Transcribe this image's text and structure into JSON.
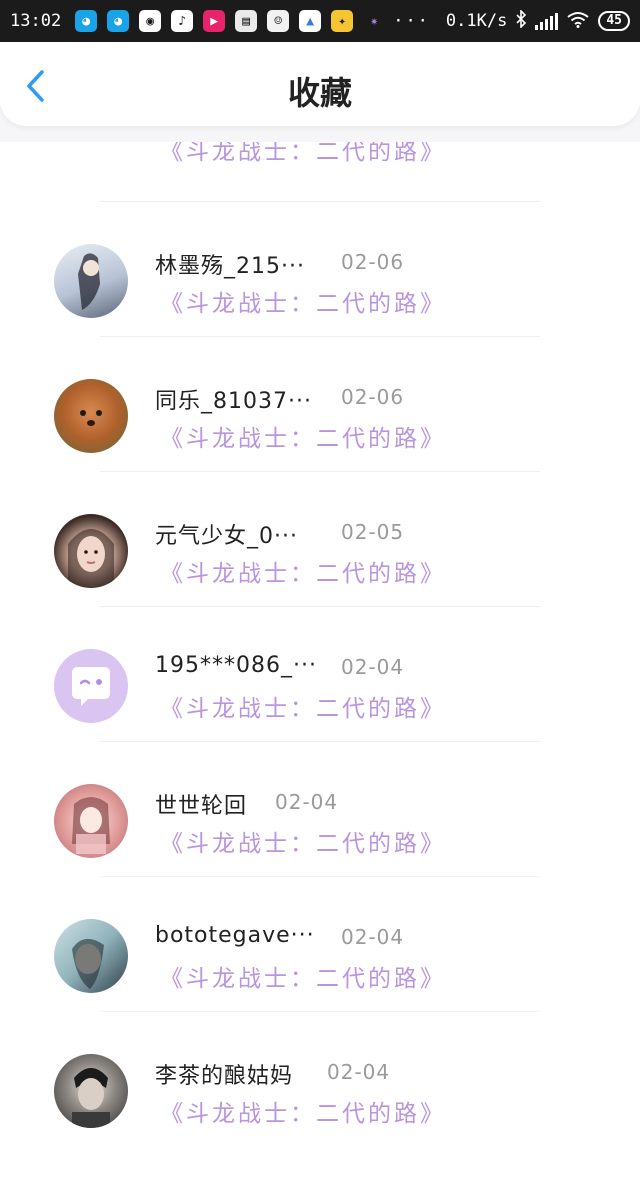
{
  "status_bar": {
    "time": "13:02",
    "dots": "···",
    "speed": "0.1K/s",
    "battery": "45",
    "app_icons": [
      "qq-icon",
      "qq-icon",
      "wechat-icon",
      "music-icon",
      "video-icon",
      "news-icon",
      "chat-icon",
      "image-icon",
      "game-icon",
      "app-icon"
    ]
  },
  "header": {
    "title": "收藏",
    "back_icon": "chevron-left-icon",
    "accent_color": "#2e9cf0"
  },
  "items": [
    {
      "name": "",
      "date": "",
      "quote": "《斗龙战士：二代的路》",
      "avatar_color": "#2a5d9c"
    },
    {
      "name": "林墨殇_215···",
      "date": "02-06",
      "quote": "《斗龙战士：二代的路》",
      "avatar_color": "#b9c6d8"
    },
    {
      "name": "同乐_81037···",
      "date": "02-06",
      "quote": "《斗龙战士：二代的路》",
      "avatar_color": "#c2773f"
    },
    {
      "name": "元气少女_0···",
      "date": "02-05",
      "quote": "《斗龙战士：二代的路》",
      "avatar_color": "#8c6a5c"
    },
    {
      "name": "195***086_···",
      "date": "02-04",
      "quote": "《斗龙战士：二代的路》",
      "avatar_color": "#d9c4f2"
    },
    {
      "name": "世世轮回",
      "date": "02-04",
      "quote": "《斗龙战士：二代的路》",
      "avatar_color": "#d99a9c"
    },
    {
      "name": "bototegave···",
      "date": "02-04",
      "quote": "《斗龙战士：二代的路》",
      "avatar_color": "#6f8f9a"
    },
    {
      "name": "李茶的酿姑妈",
      "date": "02-04",
      "quote": "《斗龙战士：二代的路》",
      "avatar_color": "#4b4b4b"
    }
  ]
}
